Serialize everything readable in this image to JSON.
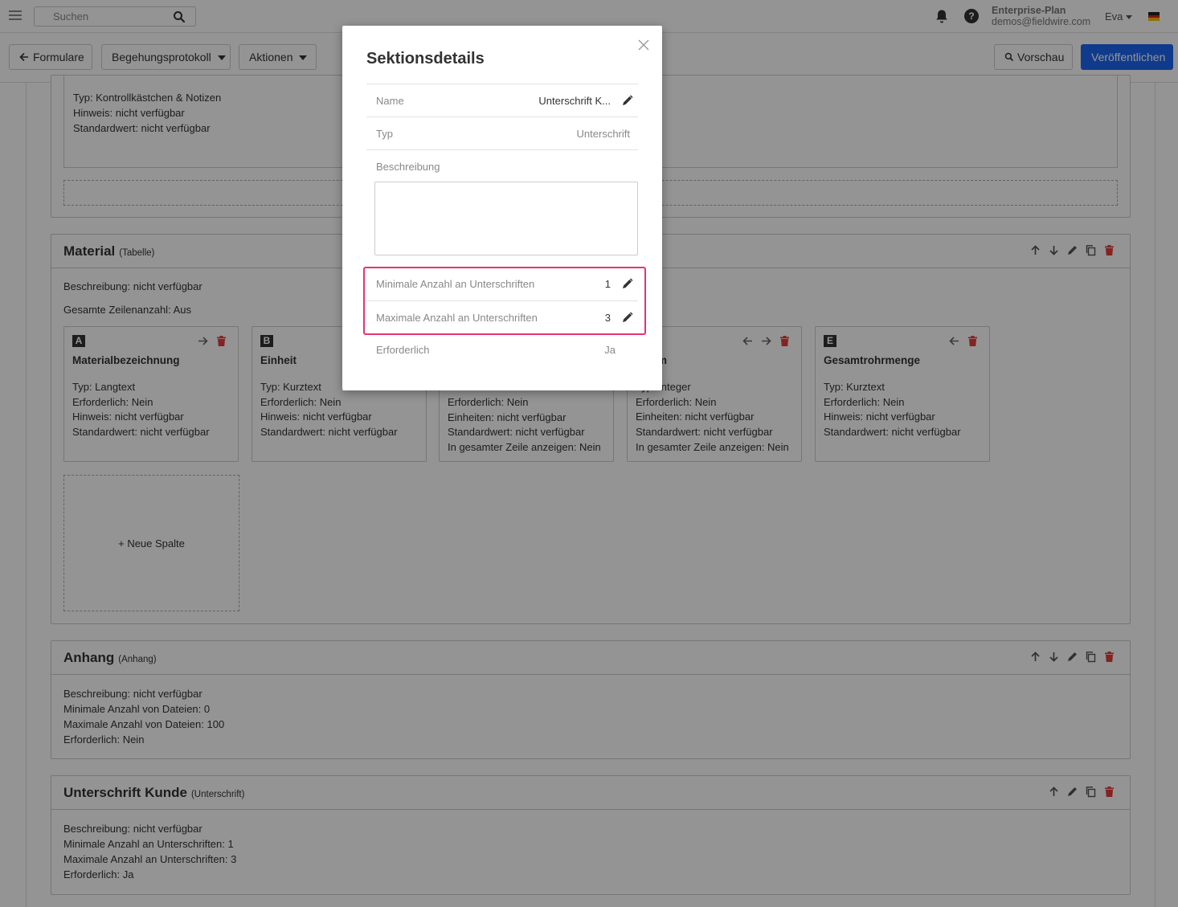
{
  "topbar": {
    "search_placeholder": "Suchen",
    "plan_label": "Enterprise-Plan",
    "email": "demos@fieldwire.com",
    "user_name": "Eva",
    "flag_icon": "germany-flag-icon"
  },
  "toolbar": {
    "forms_label": "Formulare",
    "form_select_label": "Begehungsprotokoll",
    "actions_label": "Aktionen",
    "preview_label": "Vorschau",
    "publish_label": "Veröffentlichen"
  },
  "sections": {
    "top_partial": {
      "lines": [
        "Typ: Kontrollkästchen & Notizen",
        "Hinweis: nicht verfügbar",
        "Standardwert: nicht verfügbar"
      ]
    },
    "material": {
      "title": "Material",
      "type": "(Tabelle)",
      "description": "Beschreibung: nicht verfügbar",
      "row_count": "Gesamte Zeilenanzahl: Aus",
      "columns": [
        {
          "letter": "A",
          "title": "Materialbezeichnung",
          "lines": [
            "Typ: Langtext",
            "Erforderlich: Nein",
            "Hinweis: nicht verfügbar",
            "Standardwert: nicht verfügbar"
          ]
        },
        {
          "letter": "B",
          "title": "Einheit",
          "lines": [
            "Typ: Kurztext",
            "Erforderlich: Nein",
            "Hinweis: nicht verfügbar",
            "Standardwert: nicht verfügbar"
          ]
        },
        {
          "letter": "",
          "title": "",
          "lines": [
            "Erforderlich: Nein",
            "Einheiten: nicht verfügbar",
            "Standardwert: nicht verfügbar",
            "In gesamter Zeile anzeigen: Nein"
          ]
        },
        {
          "letter": "",
          "title": "e in m",
          "lines": [
            "Typ: Integer",
            "Erforderlich: Nein",
            "Einheiten: nicht verfügbar",
            "Standardwert: nicht verfügbar",
            "In gesamter Zeile anzeigen: Nein"
          ]
        },
        {
          "letter": "E",
          "title": "Gesamtrohrmenge",
          "lines": [
            "Typ: Kurztext",
            "Erforderlich: Nein",
            "Hinweis: nicht verfügbar",
            "Standardwert: nicht verfügbar"
          ]
        }
      ],
      "new_column_label": "+ Neue Spalte"
    },
    "attachment": {
      "title": "Anhang",
      "type": "(Anhang)",
      "lines": [
        "Beschreibung: nicht verfügbar",
        "Minimale Anzahl von Dateien: 0",
        "Maximale Anzahl von Dateien: 100",
        "Erforderlich: Nein"
      ]
    },
    "signature": {
      "title": "Unterschrift Kunde",
      "type": "(Unterschrift)",
      "lines": [
        "Beschreibung: nicht verfügbar",
        "Minimale Anzahl an Unterschriften: 1",
        "Maximale Anzahl an Unterschriften: 3",
        "Erforderlich: Ja"
      ]
    }
  },
  "modal": {
    "title": "Sektionsdetails",
    "rows": {
      "name": {
        "label": "Name",
        "value": "Unterschrift K..."
      },
      "type": {
        "label": "Typ",
        "value": "Unterschrift"
      },
      "description": {
        "label": "Beschreibung"
      },
      "min_signatures": {
        "label": "Minimale Anzahl an Unterschriften",
        "value": "1"
      },
      "max_signatures": {
        "label": "Maximale Anzahl an Unterschriften",
        "value": "3"
      },
      "required": {
        "label": "Erforderlich",
        "value": "Ja"
      }
    }
  },
  "colors": {
    "primary": "#1d67f2",
    "danger": "#e33b3b",
    "highlight": "#e8336d",
    "overlay": "rgba(0,0,0,0.42)"
  }
}
